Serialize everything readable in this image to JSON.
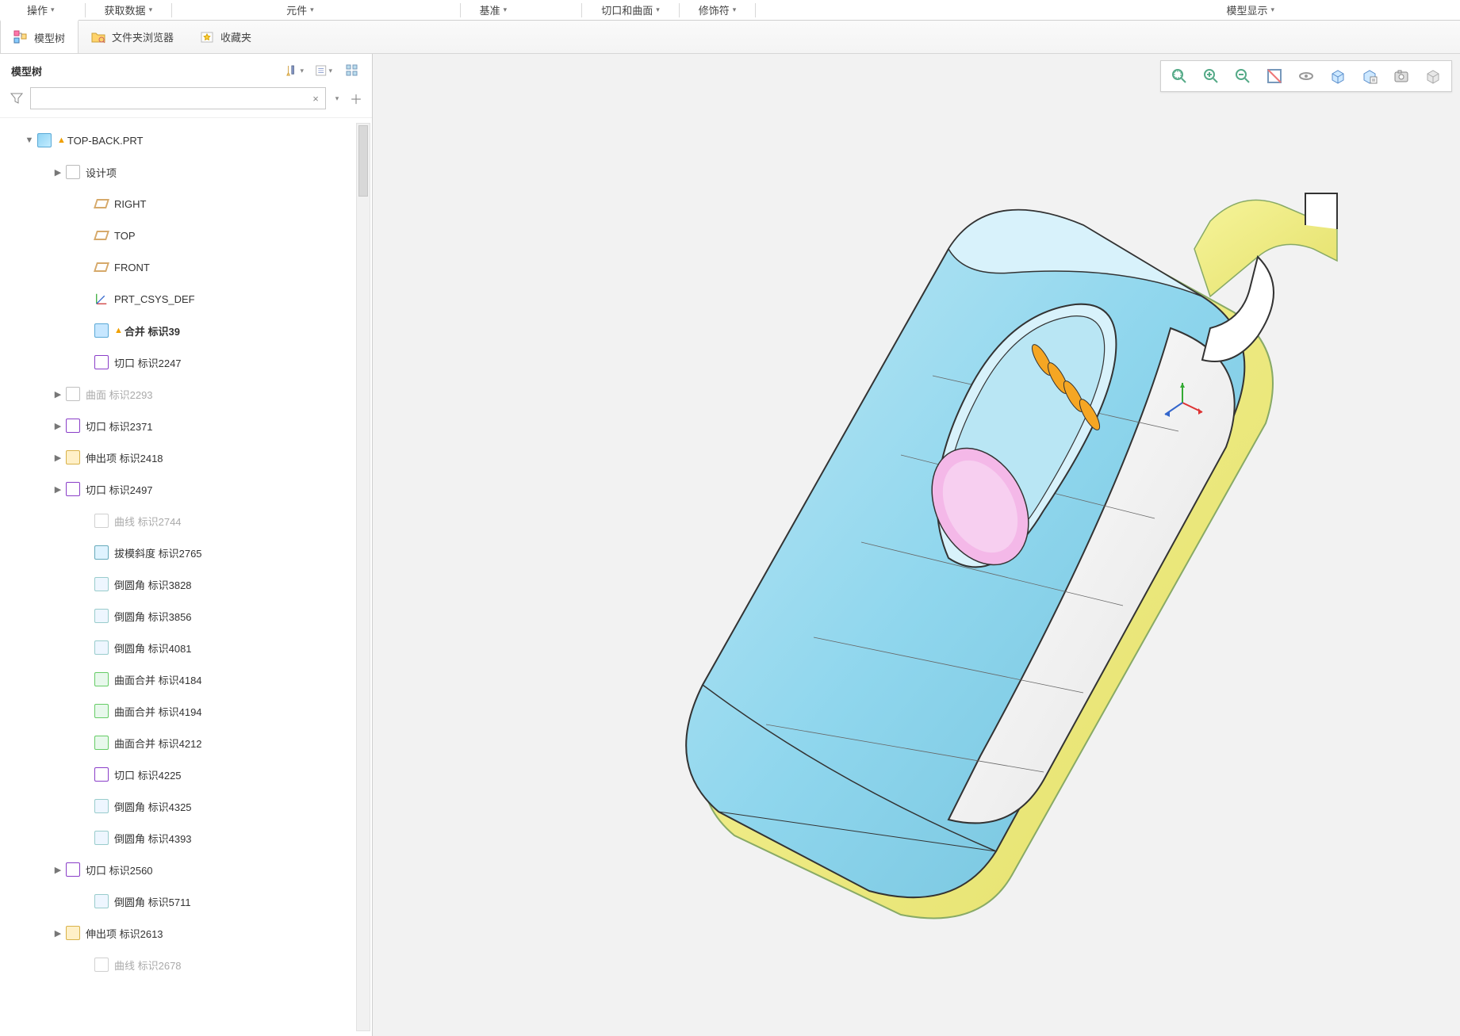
{
  "ribbon": {
    "items": [
      {
        "label": "操作"
      },
      {
        "label": "获取数据"
      },
      {
        "label": "元件"
      },
      {
        "label": "基准"
      },
      {
        "label": "切口和曲面"
      },
      {
        "label": "修饰符"
      },
      {
        "label": "模型显示"
      }
    ]
  },
  "tabs": {
    "model_tree": {
      "label": "模型树"
    },
    "folder_browser": {
      "label": "文件夹浏览器"
    },
    "favorites": {
      "label": "收藏夹"
    }
  },
  "sidebar": {
    "title": "模型树",
    "search_placeholder": ""
  },
  "tree": {
    "root": {
      "label": "TOP-BACK.PRT",
      "warn": true,
      "icon": "part"
    },
    "nodes": [
      {
        "indent": 1,
        "exp": "▶",
        "icon": "folder",
        "label": "设计项"
      },
      {
        "indent": 2,
        "exp": "",
        "icon": "plane",
        "label": "RIGHT"
      },
      {
        "indent": 2,
        "exp": "",
        "icon": "plane",
        "label": "TOP"
      },
      {
        "indent": 2,
        "exp": "",
        "icon": "plane",
        "label": "FRONT"
      },
      {
        "indent": 2,
        "exp": "",
        "icon": "csys",
        "label": "PRT_CSYS_DEF"
      },
      {
        "indent": 2,
        "exp": "",
        "icon": "merge",
        "label": "合并 标识39",
        "bold": true,
        "warn": true
      },
      {
        "indent": 2,
        "exp": "",
        "icon": "cut",
        "label": "切口 标识2247"
      },
      {
        "indent": 1,
        "exp": "▶",
        "icon": "surf",
        "label": "曲面 标识2293",
        "muted": true
      },
      {
        "indent": 1,
        "exp": "▶",
        "icon": "cut",
        "label": "切口 标识2371"
      },
      {
        "indent": 1,
        "exp": "▶",
        "icon": "extr",
        "label": "伸出项 标识2418"
      },
      {
        "indent": 1,
        "exp": "▶",
        "icon": "cut",
        "label": "切口 标识2497"
      },
      {
        "indent": 2,
        "exp": "",
        "icon": "curve",
        "label": "曲线 标识2744",
        "muted": true
      },
      {
        "indent": 2,
        "exp": "",
        "icon": "draft",
        "label": "拔模斜度 标识2765"
      },
      {
        "indent": 2,
        "exp": "",
        "icon": "round",
        "label": "倒圆角 标识3828"
      },
      {
        "indent": 2,
        "exp": "",
        "icon": "round",
        "label": "倒圆角 标识3856"
      },
      {
        "indent": 2,
        "exp": "",
        "icon": "round",
        "label": "倒圆角 标识4081"
      },
      {
        "indent": 2,
        "exp": "",
        "icon": "smerge",
        "label": "曲面合并 标识4184"
      },
      {
        "indent": 2,
        "exp": "",
        "icon": "smerge",
        "label": "曲面合并 标识4194"
      },
      {
        "indent": 2,
        "exp": "",
        "icon": "smerge",
        "label": "曲面合并 标识4212"
      },
      {
        "indent": 2,
        "exp": "",
        "icon": "cut",
        "label": "切口 标识4225"
      },
      {
        "indent": 2,
        "exp": "",
        "icon": "round",
        "label": "倒圆角 标识4325"
      },
      {
        "indent": 2,
        "exp": "",
        "icon": "round",
        "label": "倒圆角 标识4393"
      },
      {
        "indent": 1,
        "exp": "▶",
        "icon": "cut",
        "label": "切口 标识2560"
      },
      {
        "indent": 2,
        "exp": "",
        "icon": "round",
        "label": "倒圆角 标识5711"
      },
      {
        "indent": 1,
        "exp": "▶",
        "icon": "extr",
        "label": "伸出项 标识2613"
      },
      {
        "indent": 2,
        "exp": "",
        "icon": "curve",
        "label": "曲线 标识2678",
        "muted": true
      }
    ]
  },
  "vptoolbar": {
    "buttons": [
      "zoom-fit",
      "zoom-in",
      "zoom-out",
      "refit-view",
      "spin",
      "view-cube",
      "saved-view",
      "screenshot",
      "display-style"
    ]
  }
}
